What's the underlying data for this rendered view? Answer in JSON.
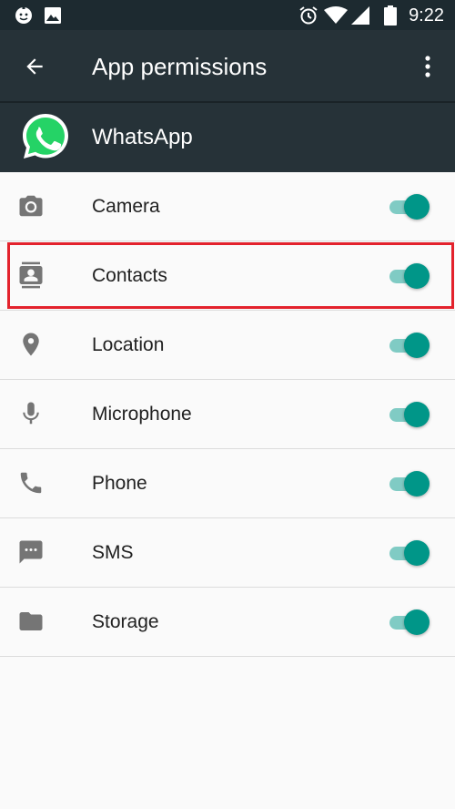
{
  "status_bar": {
    "time": "9:22",
    "icons": [
      "android-face-icon",
      "image-icon",
      "alarm-icon",
      "wifi-icon",
      "signal-icon",
      "battery-icon"
    ]
  },
  "app_bar": {
    "title": "App permissions",
    "back_icon": "arrow-back-icon",
    "menu_icon": "more-vert-icon"
  },
  "app_header": {
    "app_name": "WhatsApp",
    "app_icon": "whatsapp-logo-icon"
  },
  "permissions": [
    {
      "label": "Camera",
      "icon": "camera-icon",
      "enabled": true
    },
    {
      "label": "Contacts",
      "icon": "contacts-icon",
      "enabled": true,
      "highlighted": true
    },
    {
      "label": "Location",
      "icon": "location-pin-icon",
      "enabled": true
    },
    {
      "label": "Microphone",
      "icon": "microphone-icon",
      "enabled": true
    },
    {
      "label": "Phone",
      "icon": "phone-icon",
      "enabled": true
    },
    {
      "label": "SMS",
      "icon": "sms-icon",
      "enabled": true
    },
    {
      "label": "Storage",
      "icon": "folder-icon",
      "enabled": true
    }
  ],
  "colors": {
    "status_bar": "#1d2a30",
    "app_bar": "#263238",
    "toggle_thumb": "#009688",
    "toggle_track": "#80cbc4",
    "highlight": "#e3222c",
    "whatsapp_green": "#25d366"
  }
}
